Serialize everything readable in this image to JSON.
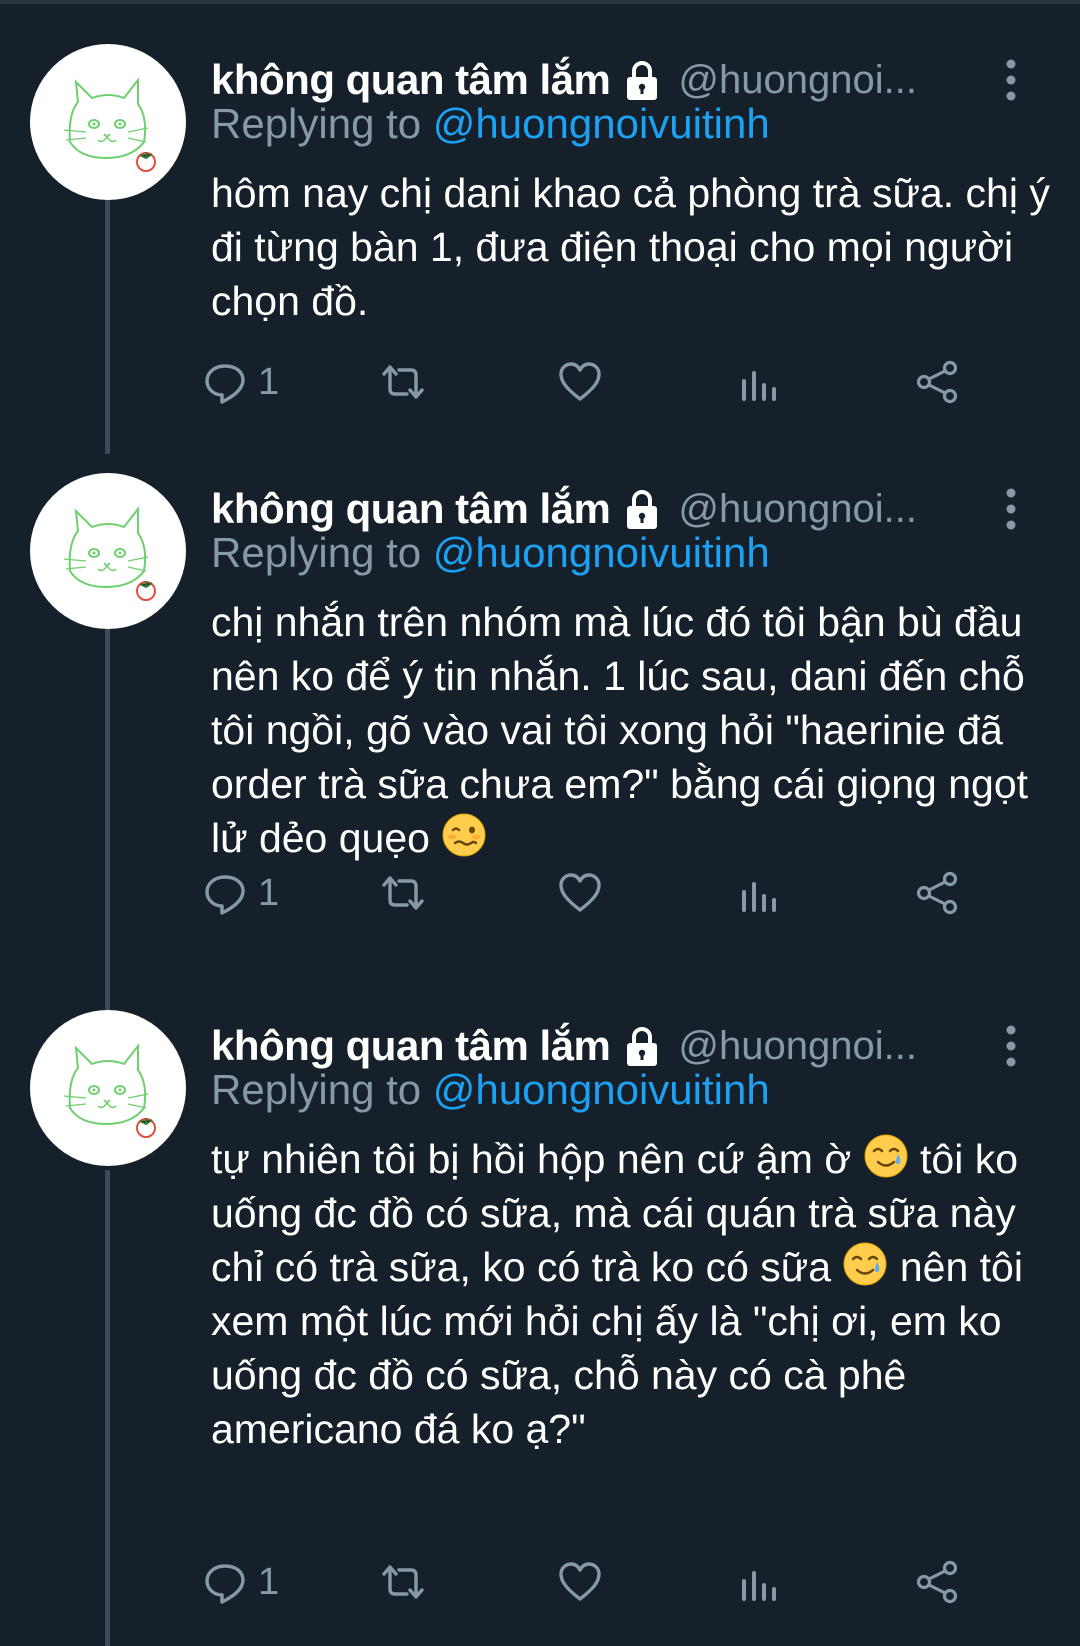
{
  "tweets": [
    {
      "display_name": "không quan tâm lắm",
      "handle": "@huongnoi...",
      "replying_prefix": "Replying to ",
      "replying_to": "@huongnoivuitinh",
      "text": "hôm nay chị dani khao cả phòng trà sữa. chị ý đi từng bàn 1, đưa điện thoại cho mọi người chọn đồ.",
      "reply_count": "1"
    },
    {
      "display_name": "không quan tâm lắm",
      "handle": "@huongnoi...",
      "replying_prefix": "Replying to ",
      "replying_to": "@huongnoivuitinh",
      "text": "chị nhắn trên nhóm mà lúc đó tôi bận bù đầu nên ko để ý tin nhắn. 1 lúc sau, dani đến chỗ tôi ngồi, gõ vào vai tôi xong hỏi \"haerinie đã order trà sữa chưa em?\" bằng cái giọng ngọt lử dẻo quẹo",
      "reply_count": "1"
    },
    {
      "display_name": "không quan tâm lắm",
      "handle": "@huongnoi...",
      "replying_prefix": "Replying to ",
      "replying_to": "@huongnoivuitinh",
      "text_parts": [
        "tự nhiên tôi bị hồi hộp nên cứ ậm ờ",
        "tôi ko uống đc đồ có sữa, mà cái quán trà sữa này chỉ có trà sữa, ko có trà ko có sữa",
        "nên tôi xem một lúc mới hỏi chị ấy là \"chị ơi, em ko uống đc đồ có sữa, chỗ này có cà phê americano đá ko ạ?\""
      ],
      "reply_count": "1"
    }
  ],
  "icons": {
    "lock": "lock-icon",
    "more": "more-vertical-icon",
    "reply": "reply-icon",
    "retweet": "retweet-icon",
    "like": "heart-icon",
    "analytics": "analytics-icon",
    "share": "share-icon",
    "emoji_woozy": "woozy-face-emoji",
    "emoji_tear": "smiling-face-with-tear-emoji"
  },
  "colors": {
    "background": "#15202b",
    "text": "#ffffff",
    "secondary": "#8899a6",
    "link": "#1da1f2",
    "thread_line": "#3d4a57"
  }
}
